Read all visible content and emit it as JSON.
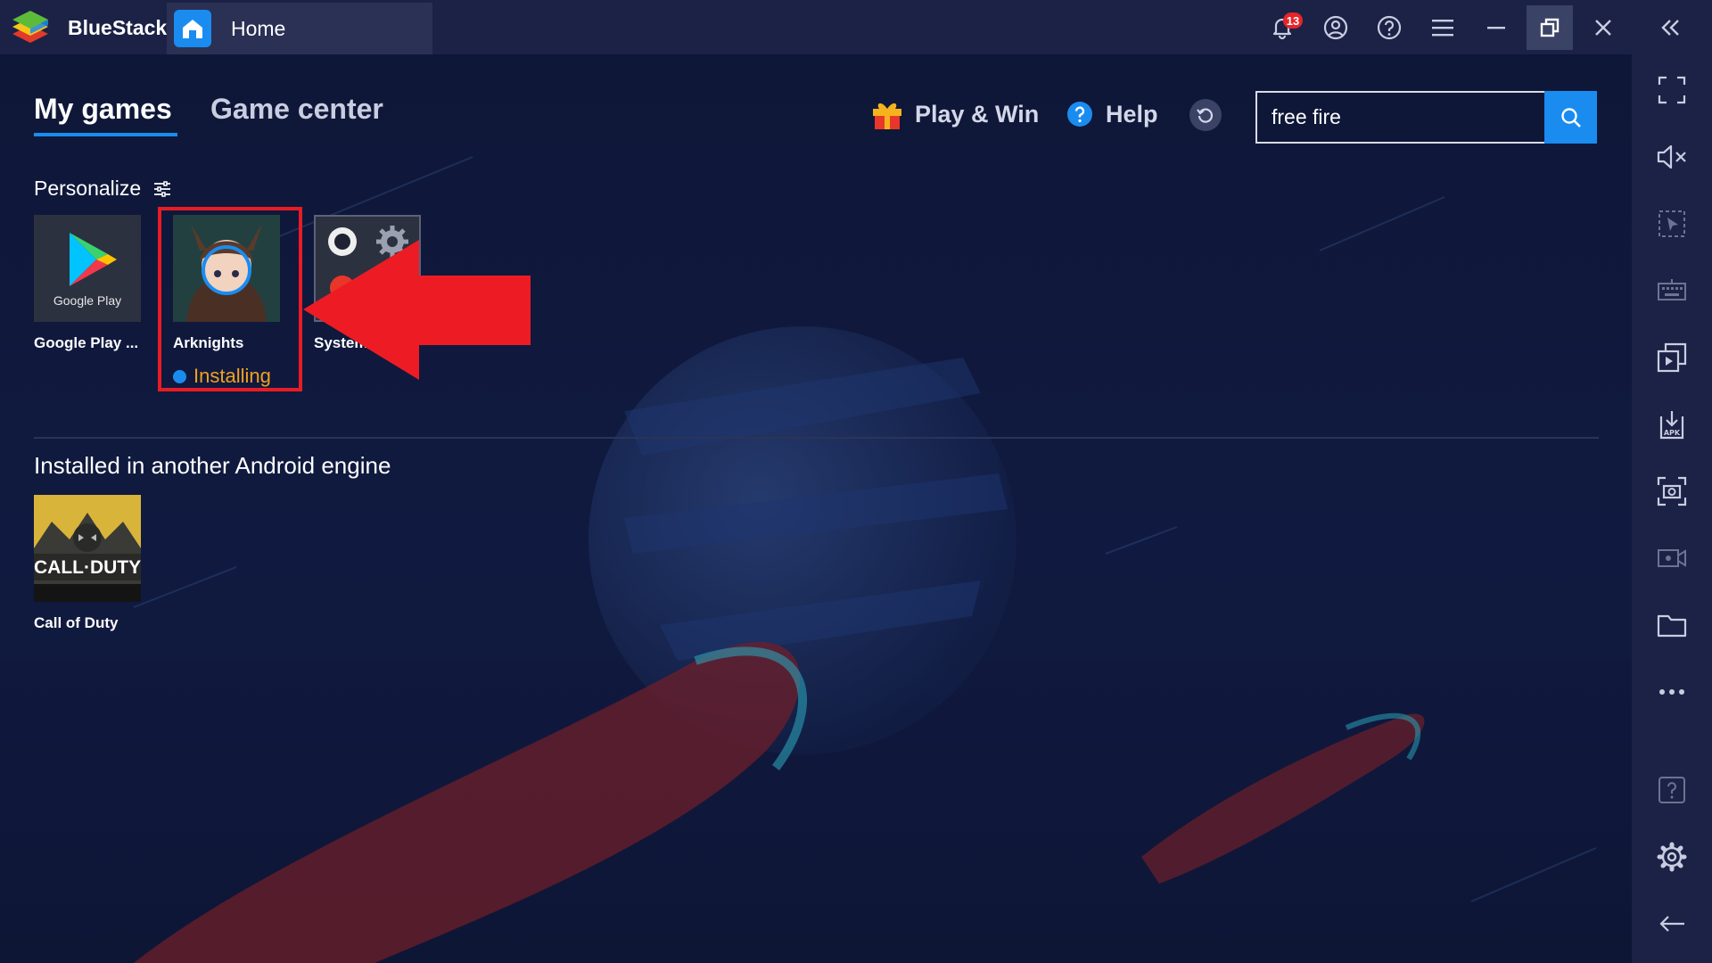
{
  "app": {
    "name": "BlueStacks",
    "tab_label": "Home",
    "notification_count": "13"
  },
  "titlebar": {
    "buttons": [
      "bell-icon",
      "account-icon",
      "help-icon",
      "menu-icon",
      "minimize-icon",
      "restore-icon",
      "close-icon",
      "collapse-icon"
    ]
  },
  "nav": {
    "tabs": [
      {
        "label": "My games",
        "active": true
      },
      {
        "label": "Game center",
        "active": false
      }
    ]
  },
  "toolbar": {
    "play_win_label": "Play & Win",
    "help_label": "Help",
    "search_value": "free fire"
  },
  "personalize": {
    "label": "Personalize",
    "apps": [
      {
        "name": "Google Play ...",
        "icon_text": "Google Play",
        "icon": "google-play-icon"
      },
      {
        "name": "Arknights",
        "status": "Installing",
        "icon": "arknights-icon"
      },
      {
        "name": "System",
        "icon": "system-settings-icon"
      }
    ]
  },
  "other_engine": {
    "label": "Installed in another Android engine",
    "apps": [
      {
        "name": "Call of Duty",
        "icon_text": "CALL·DUTY",
        "icon": "call-of-duty-icon"
      }
    ]
  },
  "sidebar": {
    "buttons": [
      "fullscreen-icon",
      "volume-mute-icon",
      "pointer-icon",
      "keyboard-icon",
      "multi-instance-icon",
      "apk-install-icon",
      "screenshot-icon",
      "record-icon",
      "folder-icon",
      "more-icon",
      "question-icon",
      "settings-icon",
      "back-icon"
    ]
  },
  "colors": {
    "accent": "#1a8cf0",
    "highlight": "#e81c24",
    "installing": "#f0a020",
    "background": "#0d1535",
    "bar": "#1b2246"
  }
}
